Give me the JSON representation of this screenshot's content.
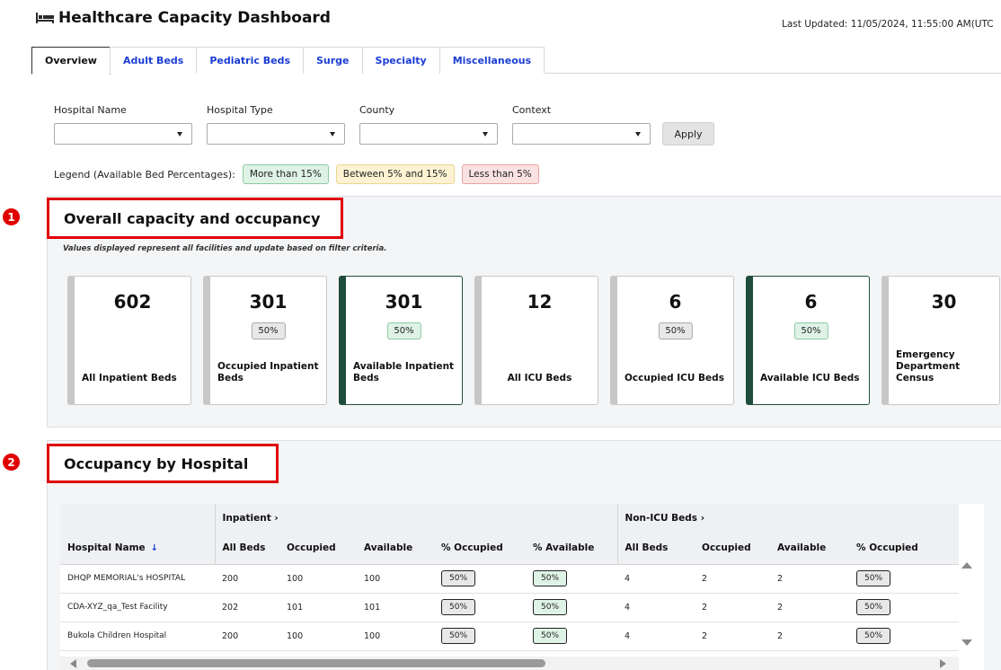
{
  "app": {
    "title": "Healthcare Capacity Dashboard",
    "last_updated": "Last Updated: 11/05/2024, 11:55:00 AM(UTC"
  },
  "tabs": [
    {
      "label": "Overview",
      "active": true
    },
    {
      "label": "Adult Beds",
      "active": false
    },
    {
      "label": "Pediatric Beds",
      "active": false
    },
    {
      "label": "Surge",
      "active": false
    },
    {
      "label": "Specialty",
      "active": false
    },
    {
      "label": "Miscellaneous",
      "active": false
    }
  ],
  "filters": {
    "hospital_name": {
      "label": "Hospital Name",
      "value": ""
    },
    "hospital_type": {
      "label": "Hospital Type",
      "value": ""
    },
    "county": {
      "label": "County",
      "value": ""
    },
    "context": {
      "label": "Context",
      "value": ""
    },
    "apply_label": "Apply"
  },
  "legend": {
    "label": "Legend (Available Bed Percentages):",
    "more": "More than 15%",
    "between": "Between 5% and 15%",
    "less": "Less than 5%"
  },
  "markers": {
    "one": "1",
    "two": "2"
  },
  "overall": {
    "title": "Overall capacity and occupancy",
    "note": "Values displayed represent all facilities and update based on filter criteria.",
    "cards": [
      {
        "value": "602",
        "badge": "",
        "label": "All Inpatient Beds"
      },
      {
        "value": "301",
        "badge": "50%",
        "label": "Occupied Inpatient Beds"
      },
      {
        "value": "301",
        "badge": "50%",
        "label": "Available Inpatient Beds"
      },
      {
        "value": "12",
        "badge": "",
        "label": "All ICU Beds"
      },
      {
        "value": "6",
        "badge": "50%",
        "label": "Occupied ICU Beds"
      },
      {
        "value": "6",
        "badge": "50%",
        "label": "Available ICU Beds"
      },
      {
        "value": "30",
        "badge": "",
        "label": "Emergency Department Census"
      }
    ]
  },
  "occupancy": {
    "title": "Occupancy by Hospital",
    "groups": {
      "inpatient": "Inpatient ›",
      "non_icu": "Non-ICU Beds ›"
    },
    "columns": {
      "hospital_name": "Hospital Name",
      "all_beds": "All Beds",
      "occupied": "Occupied",
      "available": "Available",
      "pct_occupied": "% Occupied",
      "pct_available": "% Available",
      "non_icu_all_beds": "All Beds",
      "non_icu_occupied": "Occupied",
      "non_icu_available": "Available",
      "non_icu_pct_occupied": "% Occupied"
    },
    "rows": [
      {
        "name": "DHQP MEMORIAL's HOSPITAL",
        "all": "200",
        "occ": "100",
        "avail": "100",
        "pocc": "50%",
        "pavail": "50%",
        "n_all": "4",
        "n_occ": "2",
        "n_avail": "2",
        "n_pocc": "50%"
      },
      {
        "name": "CDA-XYZ_qa_Test Facility",
        "all": "202",
        "occ": "101",
        "avail": "101",
        "pocc": "50%",
        "pavail": "50%",
        "n_all": "4",
        "n_occ": "2",
        "n_avail": "2",
        "n_pocc": "50%"
      },
      {
        "name": "Bukola Children Hospital",
        "all": "200",
        "occ": "100",
        "avail": "100",
        "pocc": "50%",
        "pavail": "50%",
        "n_all": "4",
        "n_occ": "2",
        "n_avail": "2",
        "n_pocc": "50%"
      }
    ]
  }
}
